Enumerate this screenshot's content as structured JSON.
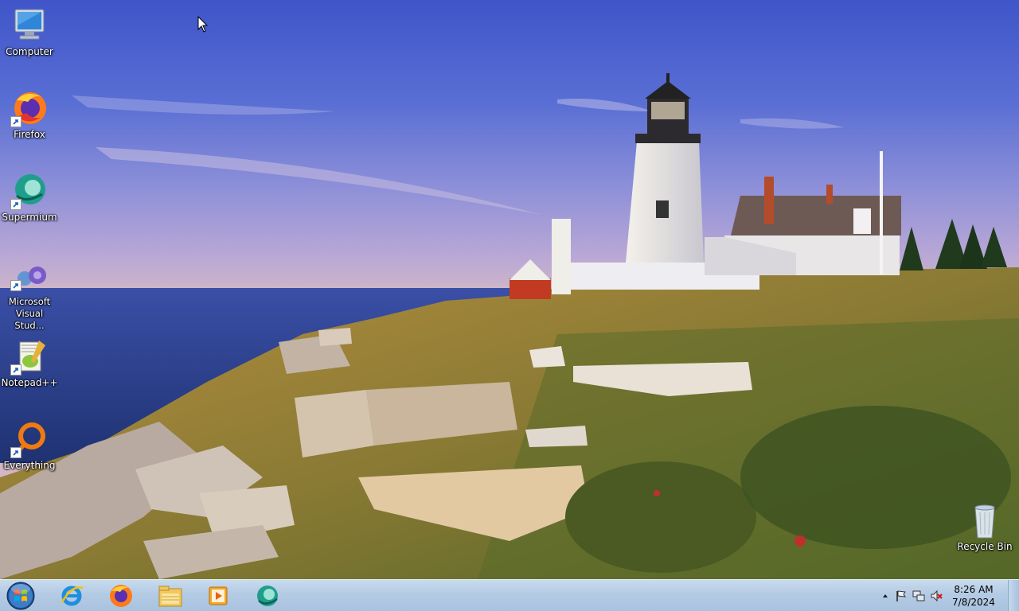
{
  "desktop": {
    "wallpaper": "lighthouse-coast",
    "icons": [
      {
        "label": "Computer",
        "icon": "computer-icon"
      },
      {
        "label": "Firefox",
        "icon": "firefox-icon"
      },
      {
        "label": "Supermium",
        "icon": "supermium-icon"
      },
      {
        "label": "Microsoft Visual Stud...",
        "icon": "visual-studio-icon"
      },
      {
        "label": "Notepad++",
        "icon": "notepadpp-icon"
      },
      {
        "label": "Everything",
        "icon": "everything-icon"
      },
      {
        "label": "Recycle Bin",
        "icon": "recycle-bin-icon"
      }
    ]
  },
  "taskbar": {
    "start": "start-orb-icon",
    "pinned": [
      {
        "icon": "internet-explorer-icon"
      },
      {
        "icon": "firefox-icon"
      },
      {
        "icon": "file-explorer-icon"
      },
      {
        "icon": "media-player-icon"
      },
      {
        "icon": "supermium-icon"
      }
    ],
    "tray": {
      "icons": [
        "show-hidden-icons-icon",
        "action-center-flag-icon",
        "network-icon",
        "volume-muted-icon"
      ],
      "time": "8:26 AM",
      "date": "7/8/2024"
    }
  },
  "colors": {
    "taskbar": "#b4cbe4",
    "sky_top": "#3f55c9",
    "sea": "#2f4a9c"
  }
}
